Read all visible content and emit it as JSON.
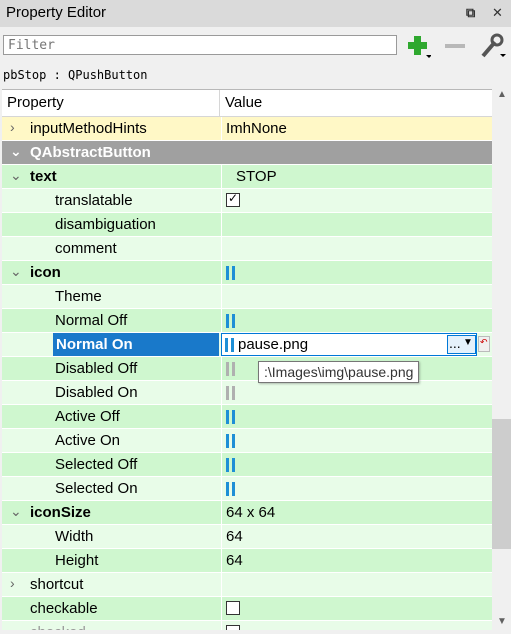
{
  "window": {
    "title": "Property Editor",
    "float_glyph": "⧉",
    "close_glyph": "✕"
  },
  "filter": {
    "placeholder": "Filter",
    "value": ""
  },
  "toolbar": {
    "add_icon": "plus-icon",
    "remove_icon": "minus-icon",
    "configure_icon": "wrench-icon"
  },
  "object_label": "pbStop : QPushButton",
  "header": {
    "property": "Property",
    "value": "Value"
  },
  "colors": {
    "green": "#cff7cf",
    "light_green": "#e8fce8",
    "yellow": "#fff8c6",
    "category": "#a0a0a0",
    "selection": "#1979ca",
    "icon_blue": "#1e8fd6",
    "icon_gray": "#b0b0b0"
  },
  "rows": [
    {
      "name": "inputMethodHints",
      "value": "ImhNone",
      "arrow": "›"
    },
    {
      "name": "QAbstractButton"
    },
    {
      "name": "text",
      "value": "STOP",
      "arrow": "⌄"
    },
    {
      "name": "translatable",
      "value": "✓"
    },
    {
      "name": "disambiguation",
      "value": ""
    },
    {
      "name": "comment",
      "value": ""
    },
    {
      "name": "icon",
      "arrow": "⌄"
    },
    {
      "name": "Theme",
      "value": ""
    },
    {
      "name": "Normal Off"
    },
    {
      "name": "Normal On",
      "value": "pause.png",
      "button": "..."
    },
    {
      "name": "Disabled Off"
    },
    {
      "name": "Disabled On"
    },
    {
      "name": "Active Off"
    },
    {
      "name": "Active On"
    },
    {
      "name": "Selected Off"
    },
    {
      "name": "Selected On"
    },
    {
      "name": "iconSize",
      "value": "64 x 64",
      "arrow": "⌄"
    },
    {
      "name": "Width",
      "value": "64"
    },
    {
      "name": "Height",
      "value": "64"
    },
    {
      "name": "shortcut",
      "value": "",
      "arrow": "›"
    },
    {
      "name": "checkable",
      "value": ""
    },
    {
      "name": "checked",
      "value": ""
    }
  ],
  "tooltip": ":\\Images\\img\\pause.png"
}
